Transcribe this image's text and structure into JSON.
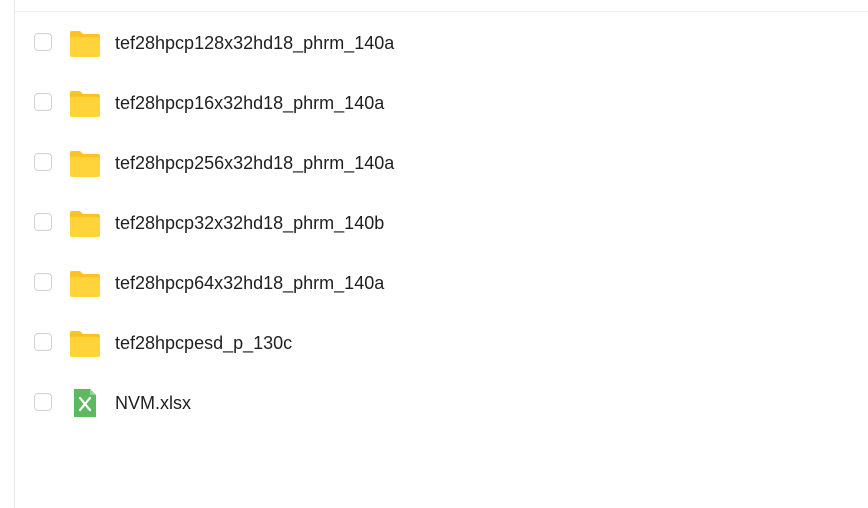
{
  "files": [
    {
      "name": "tef28hpcp128x32hd18_phrm_140a",
      "type": "folder",
      "icon": "folder-icon"
    },
    {
      "name": "tef28hpcp16x32hd18_phrm_140a",
      "type": "folder",
      "icon": "folder-icon"
    },
    {
      "name": "tef28hpcp256x32hd18_phrm_140a",
      "type": "folder",
      "icon": "folder-icon"
    },
    {
      "name": "tef28hpcp32x32hd18_phrm_140b",
      "type": "folder",
      "icon": "folder-icon"
    },
    {
      "name": "tef28hpcp64x32hd18_phrm_140a",
      "type": "folder",
      "icon": "folder-icon"
    },
    {
      "name": "tef28hpcpesd_p_130c",
      "type": "folder",
      "icon": "folder-icon"
    },
    {
      "name": "NVM.xlsx",
      "type": "xlsx",
      "icon": "excel-file-icon"
    }
  ],
  "colors": {
    "folder_body": "#FFD43A",
    "folder_tab": "#FFC21F",
    "excel_green": "#5DB85F"
  }
}
